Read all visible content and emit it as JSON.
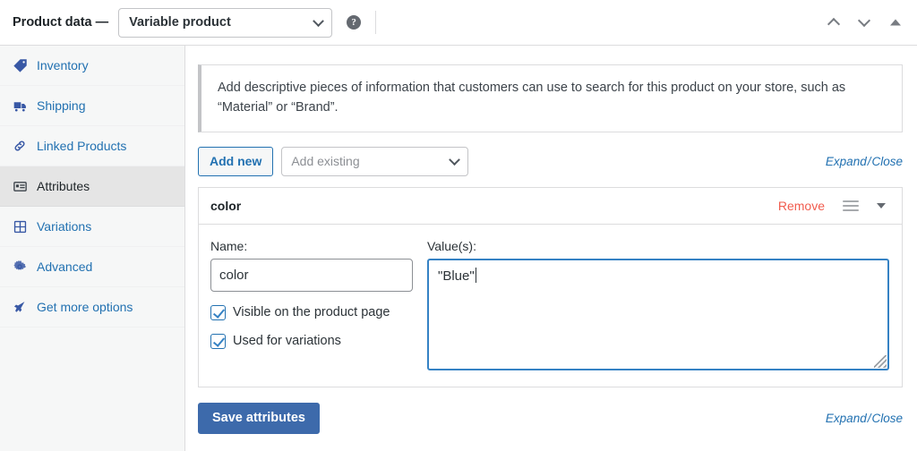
{
  "header": {
    "title": "Product data —",
    "product_type": "Variable product",
    "help_icon_glyph": "?",
    "move_up_icon": "chevron-up-icon",
    "move_down_icon": "chevron-down-icon",
    "collapse_icon": "triangle-up-icon"
  },
  "sidebar": {
    "items": [
      {
        "label": "Inventory",
        "icon": "inventory-tag-icon",
        "active": false
      },
      {
        "label": "Shipping",
        "icon": "truck-icon",
        "active": false
      },
      {
        "label": "Linked Products",
        "icon": "link-icon",
        "active": false
      },
      {
        "label": "Attributes",
        "icon": "attributes-icon",
        "active": true
      },
      {
        "label": "Variations",
        "icon": "grid-icon",
        "active": false
      },
      {
        "label": "Advanced",
        "icon": "gear-icon",
        "active": false
      },
      {
        "label": "Get more options",
        "icon": "megaphone-icon",
        "active": false
      }
    ]
  },
  "main": {
    "notice": "Add descriptive pieces of information that customers can use to search for this product on your store, such as “Material” or “Brand”.",
    "add_new_label": "Add new",
    "add_existing_placeholder": "Add existing",
    "expand_label": "Expand",
    "separator": "/",
    "close_label": "Close",
    "save_label": "Save attributes"
  },
  "attribute": {
    "name": "color",
    "remove_label": "Remove",
    "drag_handle_icon": "hamburger-handle-icon",
    "toggle_icon": "triangle-down-icon",
    "name_label": "Name:",
    "name_value": "color",
    "values_label": "Value(s):",
    "values_value": "\"Blue\"",
    "visible_label": "Visible on the product page",
    "visible_checked": true,
    "used_for_variations_label": "Used for variations",
    "used_for_variations_checked": true
  },
  "colors": {
    "link_blue": "#2271b1",
    "primary_blue": "#3d6aab",
    "focus_blue": "#3582c4",
    "remove_red": "#f15c4e",
    "sidebar_bg": "#f6f7f7",
    "active_tab_bg": "#e5e5e5",
    "border_gray": "#dcdcde"
  }
}
